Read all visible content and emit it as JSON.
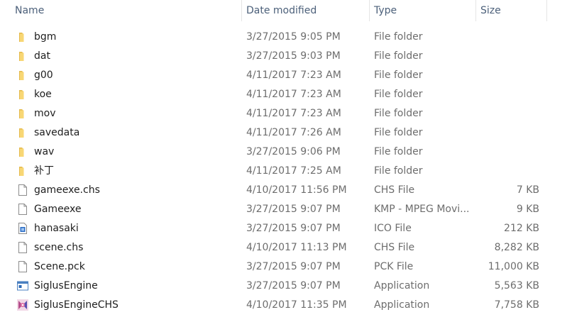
{
  "columns": {
    "name": "Name",
    "date_modified": "Date modified",
    "type": "Type",
    "size": "Size"
  },
  "files": [
    {
      "name": "bgm",
      "date": "3/27/2015 9:05 PM",
      "type": "File folder",
      "size": "",
      "icon": "folder-icon"
    },
    {
      "name": "dat",
      "date": "3/27/2015 9:03 PM",
      "type": "File folder",
      "size": "",
      "icon": "folder-icon"
    },
    {
      "name": "g00",
      "date": "4/11/2017 7:23 AM",
      "type": "File folder",
      "size": "",
      "icon": "folder-icon"
    },
    {
      "name": "koe",
      "date": "4/11/2017 7:23 AM",
      "type": "File folder",
      "size": "",
      "icon": "folder-icon"
    },
    {
      "name": "mov",
      "date": "4/11/2017 7:23 AM",
      "type": "File folder",
      "size": "",
      "icon": "folder-icon"
    },
    {
      "name": "savedata",
      "date": "4/11/2017 7:26 AM",
      "type": "File folder",
      "size": "",
      "icon": "folder-icon"
    },
    {
      "name": "wav",
      "date": "3/27/2015 9:06 PM",
      "type": "File folder",
      "size": "",
      "icon": "folder-icon"
    },
    {
      "name": "补丁",
      "date": "4/11/2017 7:25 AM",
      "type": "File folder",
      "size": "",
      "icon": "folder-icon"
    },
    {
      "name": "gameexe.chs",
      "date": "4/10/2017 11:56 PM",
      "type": "CHS File",
      "size": "7 KB",
      "icon": "file-icon"
    },
    {
      "name": "Gameexe",
      "date": "3/27/2015 9:07 PM",
      "type": "KMP - MPEG Movi...",
      "size": "9 KB",
      "icon": "file-icon"
    },
    {
      "name": "hanasaki",
      "date": "3/27/2015 9:07 PM",
      "type": "ICO File",
      "size": "212 KB",
      "icon": "ico-file-icon"
    },
    {
      "name": "scene.chs",
      "date": "4/10/2017 11:13 PM",
      "type": "CHS File",
      "size": "8,282 KB",
      "icon": "file-icon"
    },
    {
      "name": "Scene.pck",
      "date": "3/27/2015 9:07 PM",
      "type": "PCK File",
      "size": "11,000 KB",
      "icon": "file-icon"
    },
    {
      "name": "SiglusEngine",
      "date": "3/27/2015 9:07 PM",
      "type": "Application",
      "size": "5,563 KB",
      "icon": "application-icon"
    },
    {
      "name": "SiglusEngineCHS",
      "date": "4/10/2017 11:35 PM",
      "type": "Application",
      "size": "7,758 KB",
      "icon": "anime-app-icon"
    }
  ],
  "colors": {
    "header_text": "#4c607a",
    "name_text": "#1e1e1e",
    "detail_text": "#6d6d6d",
    "folder": "#f8d775",
    "separator": "#e5e5e5"
  }
}
